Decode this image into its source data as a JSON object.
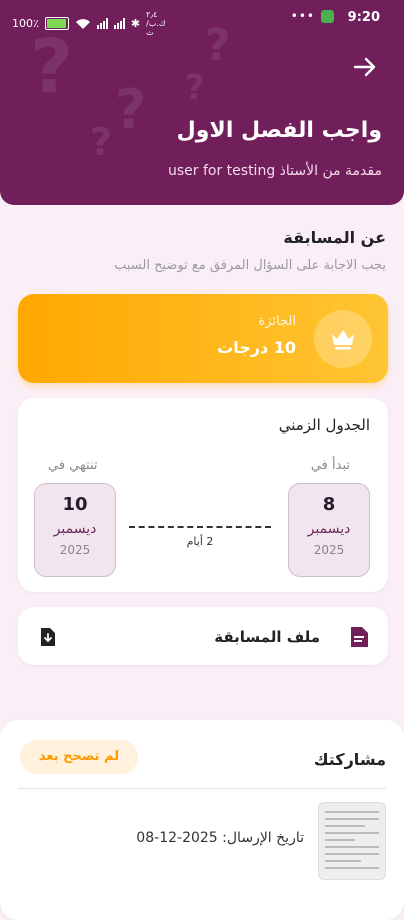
{
  "status_bar": {
    "time": "9:20",
    "battery_text": "100٪",
    "network_text": "٢٫٤ ك.ب/ث"
  },
  "header": {
    "title": "واجب الفصل الاول",
    "subtitle": "مقدمة من الأستاذ user for testing"
  },
  "about": {
    "heading": "عن المسابقة",
    "description": "يجب الاجابة على السؤال المرفق مع توضيح السبب"
  },
  "prize": {
    "label": "الجائزة",
    "value": "10 درجات"
  },
  "timeline": {
    "title": "الجدول الزمني",
    "start_label": "تبدأ في",
    "end_label": "تنتهي في",
    "start": {
      "day": "8",
      "month": "ديسمبر",
      "year": "2025"
    },
    "end": {
      "day": "10",
      "month": "ديسمبر",
      "year": "2025"
    },
    "duration": "2 أيام"
  },
  "file": {
    "label": "ملف المسابقة"
  },
  "participation": {
    "title": "مشاركتك",
    "status_badge": "لم تصحح بعد",
    "sent_date": "تاريخ الإرسال: 2025-12-08"
  },
  "colors": {
    "primary": "#701f5a",
    "accent": "#ffaa00",
    "badge_text": "#ff9800"
  },
  "icons": {
    "back": "arrow-right-icon",
    "prize": "crown-icon",
    "file": "document-icon",
    "download": "download-icon"
  }
}
